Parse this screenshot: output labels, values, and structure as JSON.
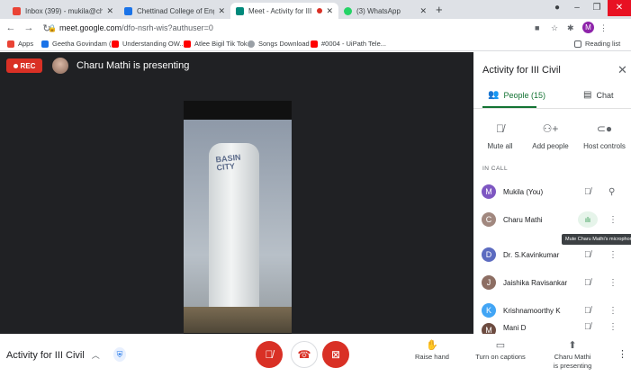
{
  "browser": {
    "tabs": [
      {
        "title": "Inbox (399) - mukila@chettinadt",
        "favicon_color": "#ea4335"
      },
      {
        "title": "Chettinad College of Engineering",
        "favicon_color": "#1a73e8"
      },
      {
        "title": "Meet - Activity for III Civil",
        "favicon_color": "#00897b"
      },
      {
        "title": "(3) WhatsApp",
        "favicon_color": "#25d366"
      }
    ],
    "url_host": "meet.google.com",
    "url_path": "/dfo-nsrh-wis?authuser=0",
    "profile_initial": "M",
    "reading_list": "Reading list"
  },
  "bookmarks": [
    {
      "label": "Apps",
      "color": "#ea4335"
    },
    {
      "label": "Geetha Govindam (...",
      "color": "#1a73e8"
    },
    {
      "label": "Understanding OW...",
      "color": "#ff0000"
    },
    {
      "label": "Atlee Bigil Tik Tok...",
      "color": "#ff0000"
    },
    {
      "label": "Songs Download",
      "color": "#9aa0a6"
    },
    {
      "label": "#0004 - UiPath Tele...",
      "color": "#ff0000"
    }
  ],
  "stage": {
    "rec_label": "REC",
    "presenting_text": "Charu Mathi is presenting",
    "tower_label": "BASIN CITY"
  },
  "panel": {
    "title": "Activity for III Civil",
    "people_tab": "People (15)",
    "chat_tab": "Chat",
    "actions": [
      "Mute all",
      "Add people",
      "Host controls"
    ],
    "in_call_label": "IN CALL",
    "participants": [
      {
        "name": "Mukila (You)",
        "initial": "M",
        "color": "#7e57c2"
      },
      {
        "name": "Charu Mathi",
        "initial": "C",
        "color": "#a1887f"
      },
      {
        "name": "Dr. S.Kavinkumar",
        "initial": "D",
        "color": "#5c6bc0"
      },
      {
        "name": "Jaishika Ravisankar",
        "initial": "J",
        "color": "#8d6e63"
      },
      {
        "name": "Krishnamoorthy K",
        "initial": "K",
        "color": "#42a5f5"
      },
      {
        "name": "Mani D",
        "initial": "M",
        "color": "#6d4c41"
      }
    ],
    "tooltip": "Mute Charu Mathi's microphone"
  },
  "bottom": {
    "meeting_title": "Activity for III Civil",
    "raise_hand": "Raise hand",
    "captions": "Turn on captions",
    "presenting_line1": "Charu Mathi",
    "presenting_line2": "is presenting"
  },
  "colors": {
    "record_red": "#d93025",
    "meet_green": "#137333"
  }
}
